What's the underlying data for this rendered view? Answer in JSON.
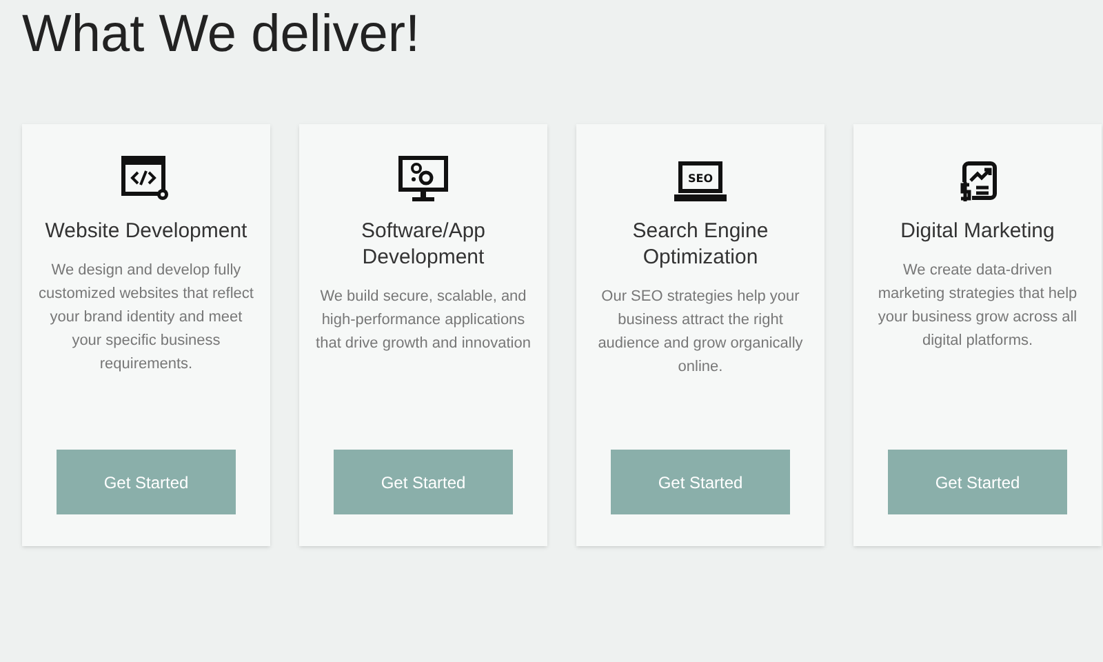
{
  "heading": "What We deliver!",
  "cards": [
    {
      "kind": "code",
      "title": "Website Development",
      "text": "We design and develop fully customized websites that reflect your brand identity and meet your specific business requirements.",
      "button": "Get Started"
    },
    {
      "kind": "software",
      "title": "Software/App Development",
      "text": "We build secure, scalable, and high-performance applications that drive growth and innovation",
      "button": "Get Started"
    },
    {
      "kind": "seo",
      "icon_label": "SEO",
      "title": "Search Engine Optimization",
      "text": "Our SEO strategies help your business attract the right audience and grow organically online.",
      "button": "Get Started"
    },
    {
      "kind": "marketing",
      "title": "Digital Marketing",
      "text": "We create data-driven marketing strategies that help your business grow across all digital platforms.",
      "button": "Get Started"
    }
  ]
}
